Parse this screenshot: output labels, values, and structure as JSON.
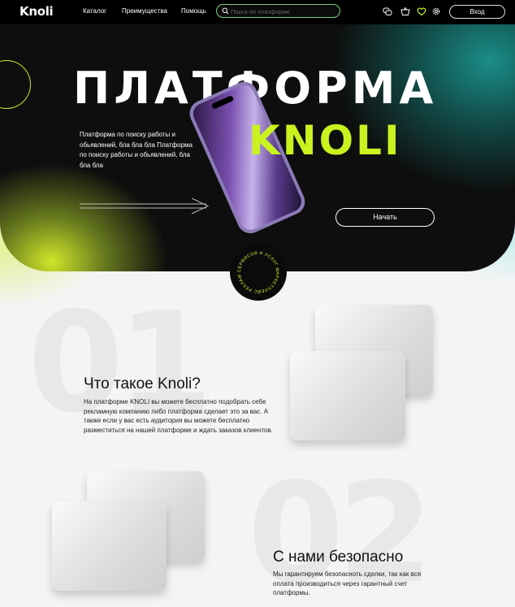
{
  "nav": {
    "logo": "Knoli",
    "links": [
      "Каталог",
      "Преимущества",
      "Помощь"
    ],
    "search_placeholder": "Поиск по платформе",
    "icons": [
      "chat-icon",
      "basket-icon",
      "heart-icon",
      "gear-icon"
    ],
    "login_label": "Вход",
    "accent_color": "#7ad37a"
  },
  "hero": {
    "title": "ПЛАТФОРМА",
    "brand": "KNOLI",
    "description": "Платформа по поиску работы и обьявлений, бла бла бла Платформа по поиску работы и обьявлений, бла бла бла",
    "start_label": "Начать",
    "brand_color": "#c9f21f",
    "badge_text": "СЕРВИСОВ И УСЛУГ МАРКЕТПЛЕЙС РЕКЛАМНЫХ ПЛОЩАДОК"
  },
  "sections": [
    {
      "number": "01",
      "title": "Что такое Knoli?",
      "text": "На платформе KNOLI вы можете бесплатно подобрать себе рекламную компанию либо платформа сделает это за вас. А также если у вас есть аудитория вы можете бесплатно разместиться на нашей платформе и ждать заказов клиентов."
    },
    {
      "number": "02",
      "title": "С нами безопасно",
      "text": "Мы гарантируем безопасноть сделки, так как вся оплата производиться через гарантный счет платформы."
    }
  ]
}
